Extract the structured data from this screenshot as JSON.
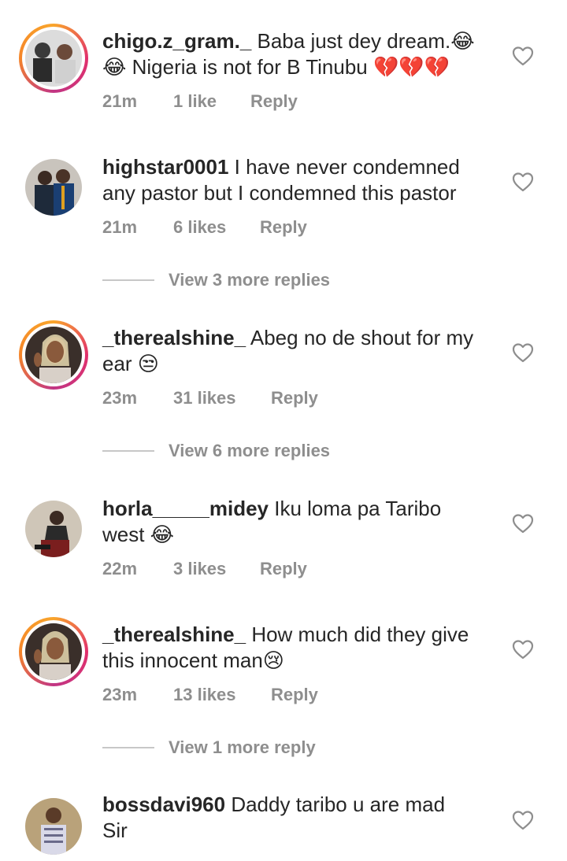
{
  "comments": [
    {
      "username": "chigo.z_gram._",
      "text": " Baba just dey dream.😂",
      "text2": "😂 Nigeria is not for B Tinubu 💔💔💔",
      "time": "21m",
      "likes": "1 like",
      "reply": "Reply"
    },
    {
      "username": "highstar0001",
      "text": " I have never condemned",
      "text2": "any pastor but I condemned this pastor",
      "time": "21m",
      "likes": "6 likes",
      "reply": "Reply",
      "more": "View 3 more replies"
    },
    {
      "username": "_therealshine_",
      "text": " Abeg no de shout for my",
      "text2": "ear 😒",
      "time": "23m",
      "likes": "31 likes",
      "reply": "Reply",
      "more": "View 6 more replies"
    },
    {
      "username": "horla_____midey",
      "text": " Iku loma pa Taribo",
      "text2": "west 😂",
      "time": "22m",
      "likes": "3 likes",
      "reply": "Reply"
    },
    {
      "username": "_therealshine_",
      "text": " How much did they give",
      "text2": "this innocent man😢",
      "time": "23m",
      "likes": "13 likes",
      "reply": "Reply",
      "more": "View 1 more reply"
    },
    {
      "username": "bossdavi960",
      "text": " Daddy taribo u are mad",
      "text2": "Sir"
    }
  ],
  "icons": {
    "like": "heart-outline-icon"
  },
  "colors": {
    "muted": "#8e8e8e",
    "text": "#262626",
    "story_ring": "#e1306c"
  }
}
